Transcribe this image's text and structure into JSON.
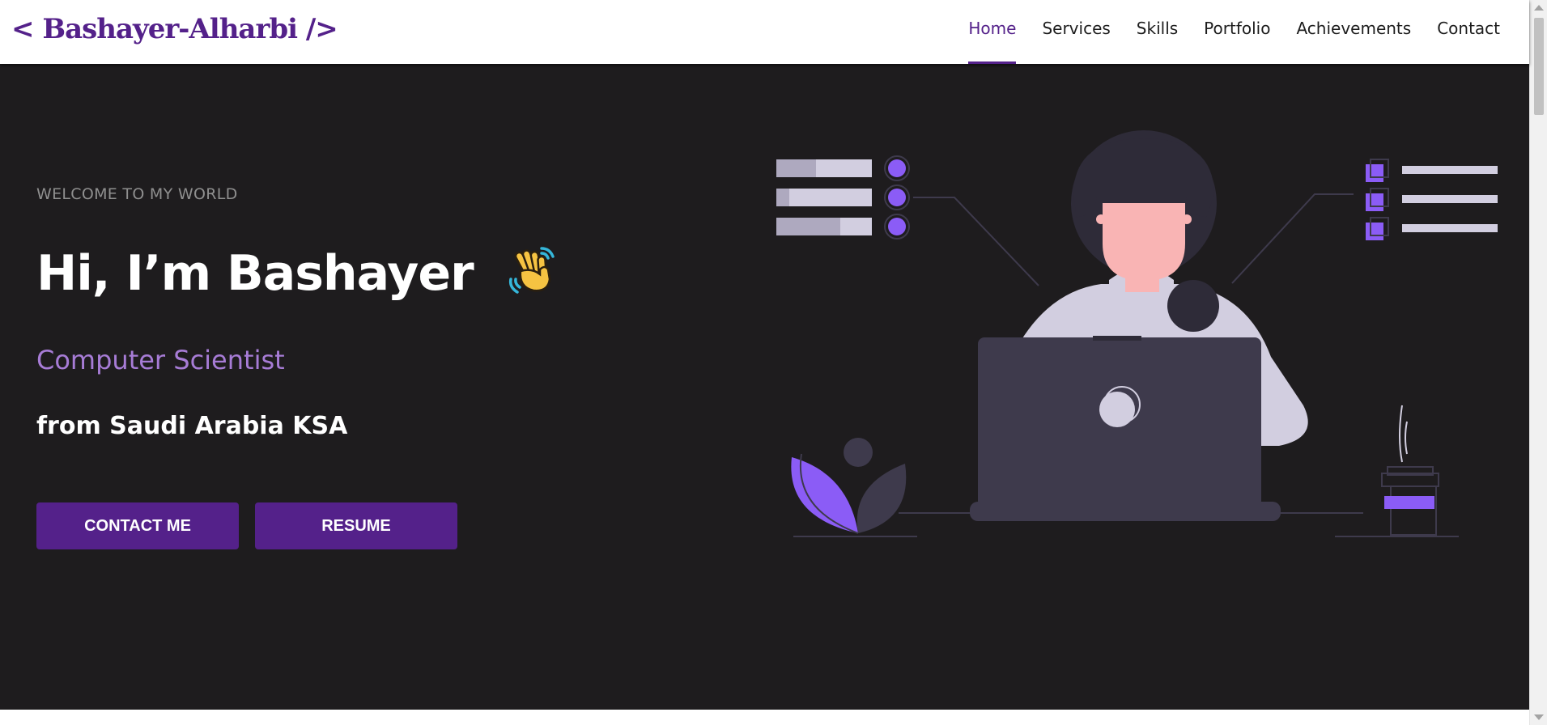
{
  "header": {
    "logo": "< Bashayer-Alharbi />",
    "nav": [
      "Home",
      "Services",
      "Skills",
      "Portfolio",
      "Achievements",
      "Contact"
    ],
    "active_nav": "Home"
  },
  "hero": {
    "welcome": "WELCOME TO MY WORLD",
    "title": "Hi, I’m Bashayer",
    "emoji": "waving-hand-icon",
    "role": "Computer Scientist",
    "origin": "from Saudi Arabia KSA",
    "buttons": {
      "contact": "CONTACT ME",
      "resume": "RESUME"
    }
  },
  "colors": {
    "brand": "#54218a",
    "hero_bg": "#1e1c1e",
    "accent": "#a77cd6",
    "illustration_purple": "#8b5cf6",
    "illustration_light": "#d2cee0",
    "illustration_dark": "#3e3a4c"
  }
}
